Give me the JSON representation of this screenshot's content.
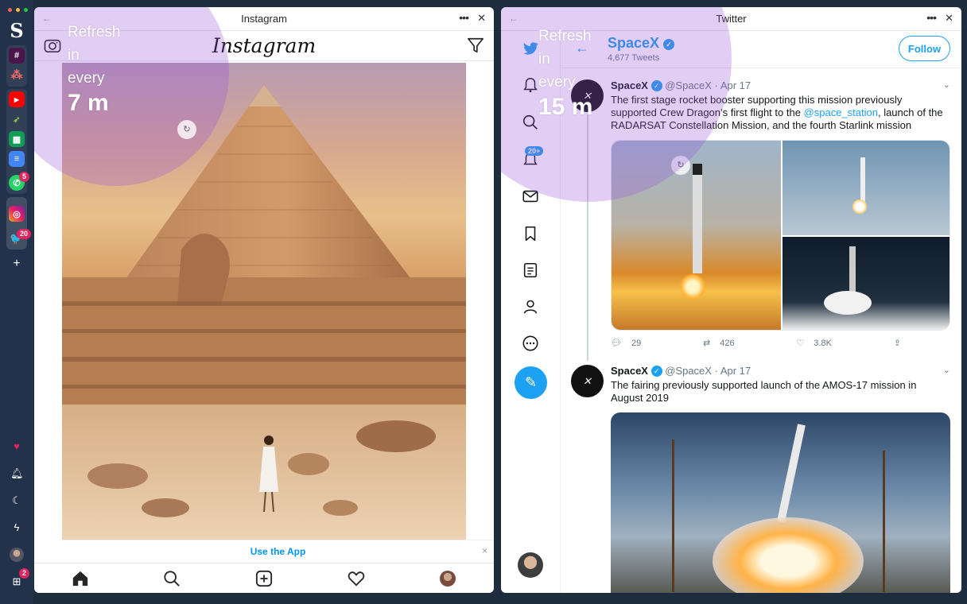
{
  "rail": {
    "badges": {
      "whatsapp": "5",
      "twitter": "20",
      "apps": "2"
    }
  },
  "instagram": {
    "window_title": "Instagram",
    "logo": "Instagram",
    "refresh": {
      "line1": "Refresh",
      "line2": "in",
      "line3": "every",
      "interval": "7 m"
    },
    "use_app": "Use the App",
    "close": "×"
  },
  "twitter": {
    "window_title": "Twitter",
    "refresh": {
      "line1": "Refresh",
      "line2": "in",
      "line3": "every",
      "interval": "15 m"
    },
    "notifications_badge": "20+",
    "profile": {
      "name": "SpaceX",
      "tweet_count": "4,677 Tweets",
      "follow_label": "Follow"
    },
    "tweets": [
      {
        "name": "SpaceX",
        "handle": "@SpaceX",
        "date": "· Apr 17",
        "text_before": "The first stage rocket booster supporting this mission previously supported Crew Dragon’s first flight to the ",
        "mention": "@space_station",
        "text_after": ", launch of the RADARSAT Constellation Mission, and the fourth Starlink mission",
        "replies": "29",
        "retweets": "426",
        "likes": "3.8K"
      },
      {
        "name": "SpaceX",
        "handle": "@SpaceX",
        "date": "· Apr 17",
        "text": "The fairing  previously supported launch of the AMOS-17 mission in August 2019"
      }
    ]
  },
  "colors": {
    "twitter_blue": "#1da1f2",
    "instagram_link": "#0095f6",
    "rail_bg": "#22324a",
    "refresh_overlay": "#9650dc"
  },
  "icons": [
    "camera-icon",
    "filter-icon",
    "home-icon",
    "search-icon",
    "add-post-icon",
    "heart-icon",
    "twitter-bird-icon",
    "mail-icon",
    "bookmark-icon",
    "lists-icon",
    "profile-icon",
    "more-icon",
    "compose-icon",
    "reply-icon",
    "retweet-icon",
    "like-icon",
    "share-icon"
  ]
}
